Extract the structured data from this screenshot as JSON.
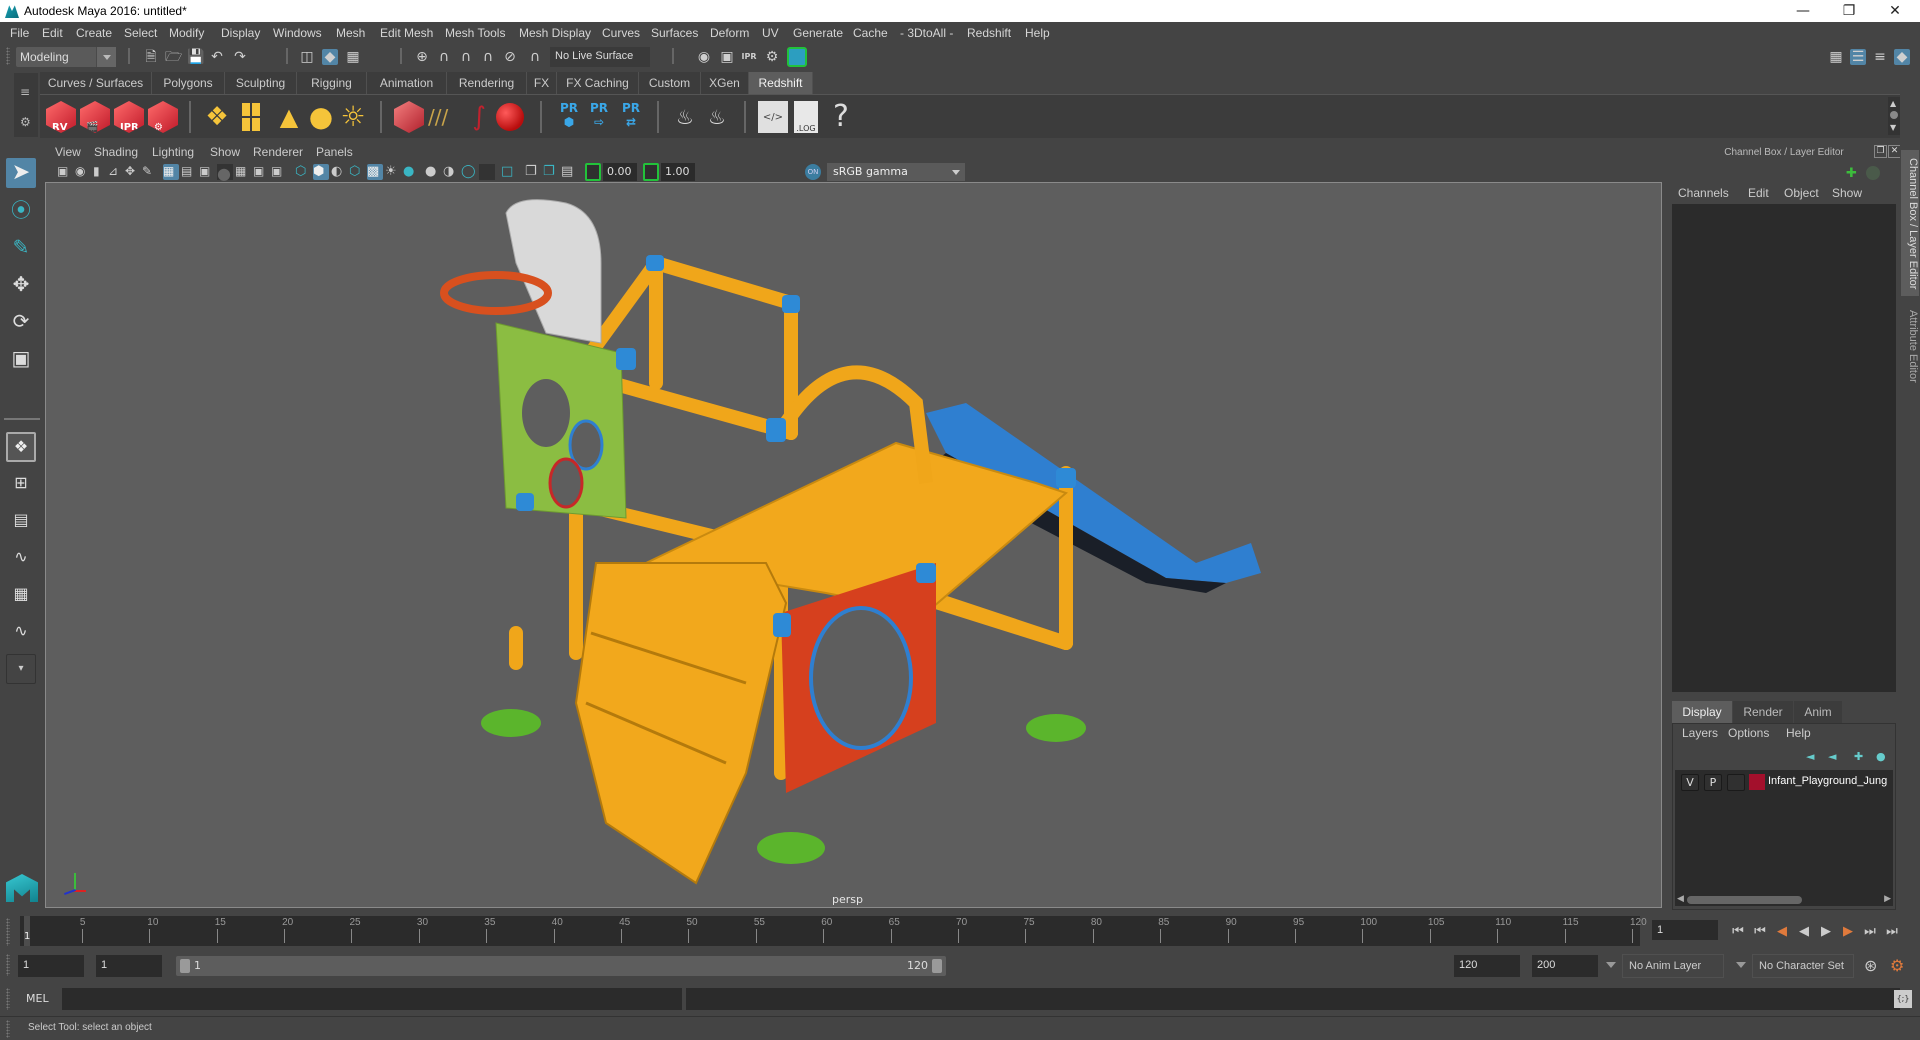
{
  "window": {
    "title": "Autodesk Maya 2016: untitled*",
    "controls": [
      "minimize",
      "restore",
      "close"
    ]
  },
  "menubar": {
    "items": [
      "File",
      "Edit",
      "Create",
      "Select",
      "Modify",
      "Display",
      "Windows",
      "Mesh",
      "Edit Mesh",
      "Mesh Tools",
      "Mesh Display",
      "Curves",
      "Surfaces",
      "Deform",
      "UV",
      "Generate",
      "Cache",
      "- 3DtoAll -",
      "Redshift",
      "Help"
    ]
  },
  "statusline": {
    "mode": "Modeling",
    "live_surface": "No Live Surface",
    "render_icons": [
      "render-view-icon",
      "render-frame-icon",
      "ipr-icon",
      "render-settings-icon",
      "hypershade-icon"
    ]
  },
  "shelf": {
    "tabs": [
      "Curves / Surfaces",
      "Polygons",
      "Sculpting",
      "Rigging",
      "Animation",
      "Rendering",
      "FX",
      "FX Caching",
      "Custom",
      "XGen",
      "Redshift"
    ],
    "active_tab": "Redshift",
    "icon_labels": {
      "rv": "RV",
      "ipr": "IPR",
      "pr": "PR",
      "log": ".LOG",
      "help": "?"
    }
  },
  "panel": {
    "menu": [
      "View",
      "Shading",
      "Lighting",
      "Show",
      "Renderer",
      "Panels"
    ],
    "exposure": "0.00",
    "gamma": "1.00",
    "color_space": "sRGB gamma",
    "camera_label": "persp"
  },
  "channel_box": {
    "title": "Channel Box / Layer Editor",
    "menu": [
      "Channels",
      "Edit",
      "Object",
      "Show"
    ]
  },
  "layer_editor": {
    "tabs": [
      "Display",
      "Render",
      "Anim"
    ],
    "active_tab": "Display",
    "menu": [
      "Layers",
      "Options",
      "Help"
    ],
    "layers": [
      {
        "visible": "V",
        "playback": "P",
        "name": "Infant_Playground_Jung",
        "color": "#a3102c"
      }
    ]
  },
  "side_tabs": [
    "Channel Box / Layer Editor",
    "Attribute Editor"
  ],
  "timeline": {
    "ticks": [
      5,
      10,
      15,
      20,
      25,
      30,
      35,
      40,
      45,
      50,
      55,
      60,
      65,
      70,
      75,
      80,
      85,
      90,
      95,
      100,
      105,
      110,
      115,
      120
    ],
    "range": [
      1,
      120
    ],
    "current_frame_marker": "1",
    "current_frame": "1"
  },
  "range_slider": {
    "start": "1",
    "playback_start": "1",
    "range_start_label": "1",
    "range_end_label": "120",
    "playback_end": "120",
    "end": "200",
    "anim_layer": "No Anim Layer",
    "character_set": "No Character Set"
  },
  "command_line": {
    "language": "MEL",
    "input": "",
    "result": ""
  },
  "help_line": {
    "text": "Select Tool: select an object"
  },
  "colors": {
    "accent_selected": "#5285a6",
    "ui_bg": "#444444",
    "viewport_bg": "#5e5e5e",
    "redshift_red": "#d62a3a",
    "bracket_green": "#22c23a"
  }
}
